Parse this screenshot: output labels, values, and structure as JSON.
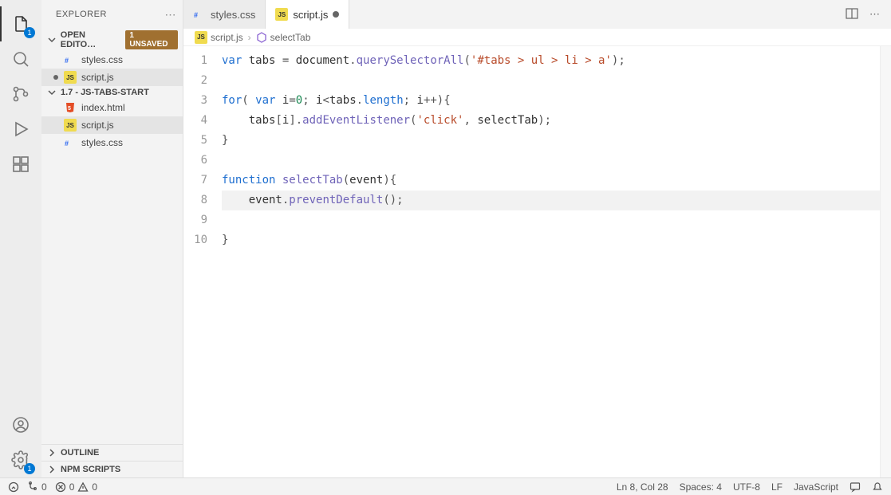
{
  "explorer": {
    "title": "EXPLORER",
    "open_editors_label": "OPEN EDITO…",
    "unsaved_label": "1 UNSAVED",
    "folder_label": "1.7 - JS-TABS-START",
    "open_editors": [
      {
        "name": "styles.css",
        "type": "css",
        "dirty": false
      },
      {
        "name": "script.js",
        "type": "js",
        "dirty": true
      }
    ],
    "files": [
      {
        "name": "index.html",
        "type": "html"
      },
      {
        "name": "script.js",
        "type": "js"
      },
      {
        "name": "styles.css",
        "type": "css"
      }
    ],
    "outline_label": "OUTLINE",
    "npm_label": "NPM SCRIPTS"
  },
  "tabs": [
    {
      "label": "styles.css",
      "type": "css",
      "active": false,
      "dirty": false
    },
    {
      "label": "script.js",
      "type": "js",
      "active": true,
      "dirty": true
    }
  ],
  "breadcrumb": {
    "file": "script.js",
    "symbol": "selectTab"
  },
  "code": {
    "lines": [
      {
        "n": 1,
        "tokens": [
          {
            "t": "var ",
            "c": "tk-kw"
          },
          {
            "t": "tabs",
            "c": "tk-id"
          },
          {
            "t": " = ",
            "c": "tk-punc"
          },
          {
            "t": "document",
            "c": "tk-id"
          },
          {
            "t": ".",
            "c": "tk-punc"
          },
          {
            "t": "querySelectorAll",
            "c": "tk-fn"
          },
          {
            "t": "(",
            "c": "tk-punc"
          },
          {
            "t": "'#tabs > ul > li > a'",
            "c": "tk-str"
          },
          {
            "t": ");",
            "c": "tk-punc"
          }
        ]
      },
      {
        "n": 2,
        "tokens": []
      },
      {
        "n": 3,
        "tokens": [
          {
            "t": "for",
            "c": "tk-kw"
          },
          {
            "t": "( ",
            "c": "tk-punc"
          },
          {
            "t": "var ",
            "c": "tk-kw"
          },
          {
            "t": "i",
            "c": "tk-id"
          },
          {
            "t": "=",
            "c": "tk-punc"
          },
          {
            "t": "0",
            "c": "tk-num"
          },
          {
            "t": "; ",
            "c": "tk-punc"
          },
          {
            "t": "i",
            "c": "tk-id"
          },
          {
            "t": "<",
            "c": "tk-punc"
          },
          {
            "t": "tabs",
            "c": "tk-id"
          },
          {
            "t": ".",
            "c": "tk-punc"
          },
          {
            "t": "length",
            "c": "tk-prop"
          },
          {
            "t": "; ",
            "c": "tk-punc"
          },
          {
            "t": "i",
            "c": "tk-id"
          },
          {
            "t": "++){",
            "c": "tk-punc"
          }
        ]
      },
      {
        "n": 4,
        "tokens": [
          {
            "t": "    tabs",
            "c": "tk-id"
          },
          {
            "t": "[",
            "c": "tk-punc"
          },
          {
            "t": "i",
            "c": "tk-id"
          },
          {
            "t": "].",
            "c": "tk-punc"
          },
          {
            "t": "addEventListener",
            "c": "tk-fn"
          },
          {
            "t": "(",
            "c": "tk-punc"
          },
          {
            "t": "'click'",
            "c": "tk-str"
          },
          {
            "t": ", ",
            "c": "tk-punc"
          },
          {
            "t": "selectTab",
            "c": "tk-id"
          },
          {
            "t": ");",
            "c": "tk-punc"
          }
        ]
      },
      {
        "n": 5,
        "tokens": [
          {
            "t": "}",
            "c": "tk-punc"
          }
        ]
      },
      {
        "n": 6,
        "tokens": []
      },
      {
        "n": 7,
        "tokens": [
          {
            "t": "function ",
            "c": "tk-kw"
          },
          {
            "t": "selectTab",
            "c": "tk-fn"
          },
          {
            "t": "(",
            "c": "tk-punc"
          },
          {
            "t": "event",
            "c": "tk-id"
          },
          {
            "t": "){",
            "c": "tk-punc"
          }
        ]
      },
      {
        "n": 8,
        "tokens": [
          {
            "t": "    event",
            "c": "tk-id"
          },
          {
            "t": ".",
            "c": "tk-punc"
          },
          {
            "t": "preventDefault",
            "c": "tk-fn"
          },
          {
            "t": "();",
            "c": "tk-punc"
          }
        ]
      },
      {
        "n": 9,
        "tokens": []
      },
      {
        "n": 10,
        "tokens": [
          {
            "t": "}",
            "c": "tk-punc"
          }
        ]
      }
    ],
    "current_line": 8
  },
  "status": {
    "sync": "0",
    "errors": "0",
    "warnings": "0",
    "ln_col": "Ln 8, Col 28",
    "spaces": "Spaces: 4",
    "encoding": "UTF-8",
    "eol": "LF",
    "language": "JavaScript"
  },
  "activity_badge": "1",
  "settings_badge": "1"
}
